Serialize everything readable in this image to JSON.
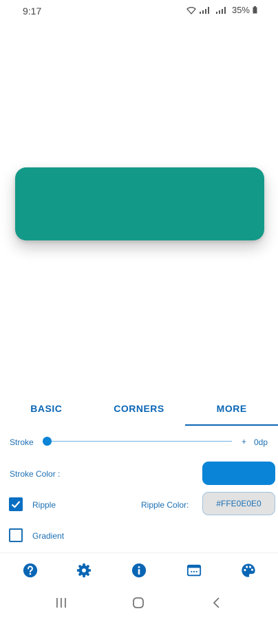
{
  "status_bar": {
    "time": "9:17",
    "battery": "35%"
  },
  "preview": {
    "button_color": "#139988"
  },
  "tabs": [
    {
      "label": "BASIC",
      "active": false
    },
    {
      "label": "CORNERS",
      "active": false
    },
    {
      "label": "MORE",
      "active": true
    }
  ],
  "stroke": {
    "label": "Stroke",
    "plus": "+",
    "value": "0dp",
    "slider_level": 0
  },
  "stroke_color": {
    "label": "Stroke Color :",
    "swatch_color": "#0a84d6"
  },
  "ripple": {
    "label": "Ripple",
    "checked": true,
    "color_label": "Ripple Color:",
    "color_value": "#FFE0E0E0"
  },
  "gradient": {
    "label": "Gradient",
    "checked": false
  },
  "bottom_nav": {
    "icons": [
      "help-icon",
      "settings-icon",
      "info-icon",
      "code-view-icon",
      "palette-icon"
    ],
    "accent": "#0a66b5"
  },
  "system_nav": {
    "icons": [
      "recents-icon",
      "home-icon",
      "back-icon"
    ]
  }
}
